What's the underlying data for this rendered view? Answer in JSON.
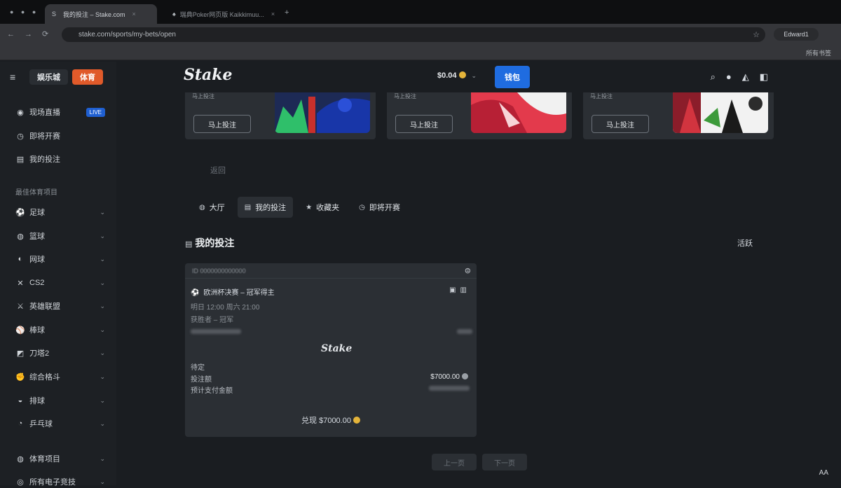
{
  "browser": {
    "tabs": [
      {
        "title": "我的投注 – Stake.com",
        "active": true
      },
      {
        "title": "瑞典Poker网页版 Kaikkimuu...",
        "active": false
      }
    ],
    "url": "stake.com/sports/my-bets/open",
    "profile_label": "Edward1",
    "bookmark_right": "所有书签"
  },
  "header": {
    "casino_label": "娱乐城",
    "sports_label": "体育",
    "logo": "Stake",
    "balance": "$0.04",
    "wallet_label": "钱包",
    "icons": [
      "search-icon",
      "user-icon",
      "notification-icon",
      "chat-icon"
    ]
  },
  "sidebar": {
    "top_items": [
      {
        "label": "现场直播",
        "icon": "live-icon",
        "badge": "LIVE"
      },
      {
        "label": "即将开赛",
        "icon": "clock-icon"
      },
      {
        "label": "我的投注",
        "icon": "receipt-icon"
      }
    ],
    "section_label": "最佳体育项目",
    "sports": [
      {
        "label": "足球",
        "icon": "soccer-icon"
      },
      {
        "label": "篮球",
        "icon": "basketball-icon"
      },
      {
        "label": "网球",
        "icon": "tennis-icon"
      },
      {
        "label": "CS2",
        "icon": "cs2-icon"
      },
      {
        "label": "英雄联盟",
        "icon": "lol-icon"
      },
      {
        "label": "棒球",
        "icon": "baseball-icon"
      },
      {
        "label": "刀塔2",
        "icon": "dota-icon"
      },
      {
        "label": "综合格斗",
        "icon": "mma-icon"
      },
      {
        "label": "排球",
        "icon": "volleyball-icon"
      },
      {
        "label": "乒乓球",
        "icon": "pingpong-icon"
      }
    ],
    "bottom_items": [
      {
        "label": "体育项目",
        "icon": "sports-icon"
      },
      {
        "label": "所有电子竞技",
        "icon": "esports-icon"
      }
    ]
  },
  "promos": [
    {
      "tagline": "马上投注",
      "button": "马上投注"
    },
    {
      "tagline": "马上投注",
      "button": "马上投注"
    },
    {
      "tagline": "马上投注",
      "button": "马上投注"
    }
  ],
  "ghost_tab": "返回",
  "tabs": [
    {
      "label": "大厅",
      "icon": "lobby-icon"
    },
    {
      "label": "我的投注",
      "icon": "receipt-icon",
      "active": true
    },
    {
      "label": "收藏夹",
      "icon": "star-icon"
    },
    {
      "label": "即将开赛",
      "icon": "clock-icon"
    }
  ],
  "section": {
    "title": "我的投注",
    "more": "活跃"
  },
  "bet_card": {
    "bet_id": "ID 0000000000000",
    "event": "欧洲杯决赛 – 冠军得主",
    "event_time": "明日 12:00 周六 21:00",
    "market": "获胜者 – 冠军",
    "logo": "Stake",
    "status": "待定",
    "stake_label": "投注额",
    "stake_value": "$7000.00",
    "payout_label": "预计支付金额",
    "cashout": "兑现 $7000.00"
  },
  "pager": {
    "prev": "上一页",
    "next": "下一页"
  },
  "corner_text": "AA"
}
